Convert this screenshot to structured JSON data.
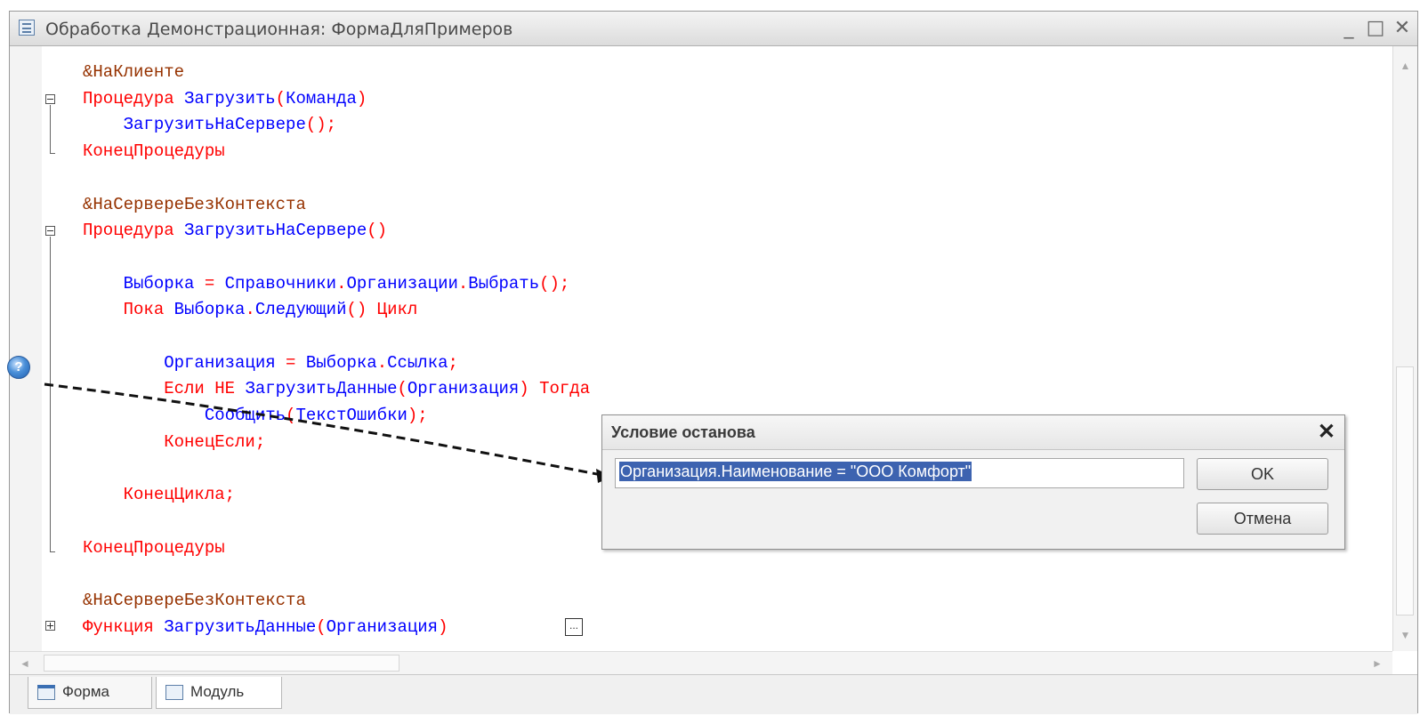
{
  "window": {
    "title": "Обработка Демонстрационная: ФормаДляПримеров",
    "minimize": "_",
    "maximize": "□",
    "close": "✕"
  },
  "code_lines": [
    {
      "parts": [
        {
          "cls": "dir",
          "text": "&НаКлиенте"
        }
      ]
    },
    {
      "parts": [
        {
          "cls": "kw",
          "text": "Процедура "
        },
        {
          "cls": "id",
          "text": "Загрузить"
        },
        {
          "cls": "kw",
          "text": "("
        },
        {
          "cls": "id",
          "text": "Команда"
        },
        {
          "cls": "kw",
          "text": ")"
        }
      ]
    },
    {
      "parts": [
        {
          "cls": "id",
          "text": "    ЗагрузитьНаСервере"
        },
        {
          "cls": "kw",
          "text": "();"
        }
      ]
    },
    {
      "parts": [
        {
          "cls": "kw",
          "text": "КонецПроцедуры"
        }
      ]
    },
    {
      "parts": []
    },
    {
      "parts": [
        {
          "cls": "dir",
          "text": "&НаСервереБезКонтекста"
        }
      ]
    },
    {
      "parts": [
        {
          "cls": "kw",
          "text": "Процедура "
        },
        {
          "cls": "id",
          "text": "ЗагрузитьНаСервере"
        },
        {
          "cls": "kw",
          "text": "()"
        }
      ]
    },
    {
      "parts": []
    },
    {
      "parts": [
        {
          "cls": "id",
          "text": "    Выборка "
        },
        {
          "cls": "kw",
          "text": "= "
        },
        {
          "cls": "id",
          "text": "Справочники"
        },
        {
          "cls": "kw",
          "text": "."
        },
        {
          "cls": "id",
          "text": "Организации"
        },
        {
          "cls": "kw",
          "text": "."
        },
        {
          "cls": "id",
          "text": "Выбрать"
        },
        {
          "cls": "kw",
          "text": "();"
        }
      ]
    },
    {
      "parts": [
        {
          "cls": "kw",
          "text": "    Пока "
        },
        {
          "cls": "id",
          "text": "Выборка"
        },
        {
          "cls": "kw",
          "text": "."
        },
        {
          "cls": "id",
          "text": "Следующий"
        },
        {
          "cls": "kw",
          "text": "() Цикл"
        }
      ]
    },
    {
      "parts": []
    },
    {
      "parts": [
        {
          "cls": "id",
          "text": "        Организация "
        },
        {
          "cls": "kw",
          "text": "= "
        },
        {
          "cls": "id",
          "text": "Выборка"
        },
        {
          "cls": "kw",
          "text": "."
        },
        {
          "cls": "id",
          "text": "Ссылка"
        },
        {
          "cls": "kw",
          "text": ";"
        }
      ]
    },
    {
      "parts": [
        {
          "cls": "kw",
          "text": "        Если НЕ "
        },
        {
          "cls": "id",
          "text": "ЗагрузитьДанные"
        },
        {
          "cls": "kw",
          "text": "("
        },
        {
          "cls": "id",
          "text": "Организация"
        },
        {
          "cls": "kw",
          "text": ") Тогда"
        }
      ]
    },
    {
      "parts": [
        {
          "cls": "id",
          "text": "            Сообщить"
        },
        {
          "cls": "kw",
          "text": "("
        },
        {
          "cls": "id",
          "text": "ТекстОшибки"
        },
        {
          "cls": "kw",
          "text": ");"
        }
      ]
    },
    {
      "parts": [
        {
          "cls": "kw",
          "text": "        КонецЕсли;"
        }
      ]
    },
    {
      "parts": []
    },
    {
      "parts": [
        {
          "cls": "kw",
          "text": "    КонецЦикла;"
        }
      ]
    },
    {
      "parts": []
    },
    {
      "parts": [
        {
          "cls": "kw",
          "text": "КонецПроцедуры"
        }
      ]
    },
    {
      "parts": []
    },
    {
      "parts": [
        {
          "cls": "dir",
          "text": "&НаСервереБезКонтекста"
        }
      ]
    },
    {
      "parts": [
        {
          "cls": "kw",
          "text": "Функция "
        },
        {
          "cls": "id",
          "text": "ЗагрузитьДанные"
        },
        {
          "cls": "kw",
          "text": "("
        },
        {
          "cls": "id",
          "text": "Организация"
        },
        {
          "cls": "kw",
          "text": ")"
        }
      ]
    }
  ],
  "collapsed_marker": "...",
  "dialog": {
    "title": "Условие останова",
    "close": "✕",
    "condition_value": "Организация.Наименование = \"ООО Комфорт\"",
    "ok_label": "OK",
    "cancel_label": "Отмена"
  },
  "tabs": [
    {
      "label": "Форма",
      "icon": "form-icon"
    },
    {
      "label": "Модуль",
      "icon": "module-icon"
    }
  ],
  "breakpoint_icon": "?"
}
